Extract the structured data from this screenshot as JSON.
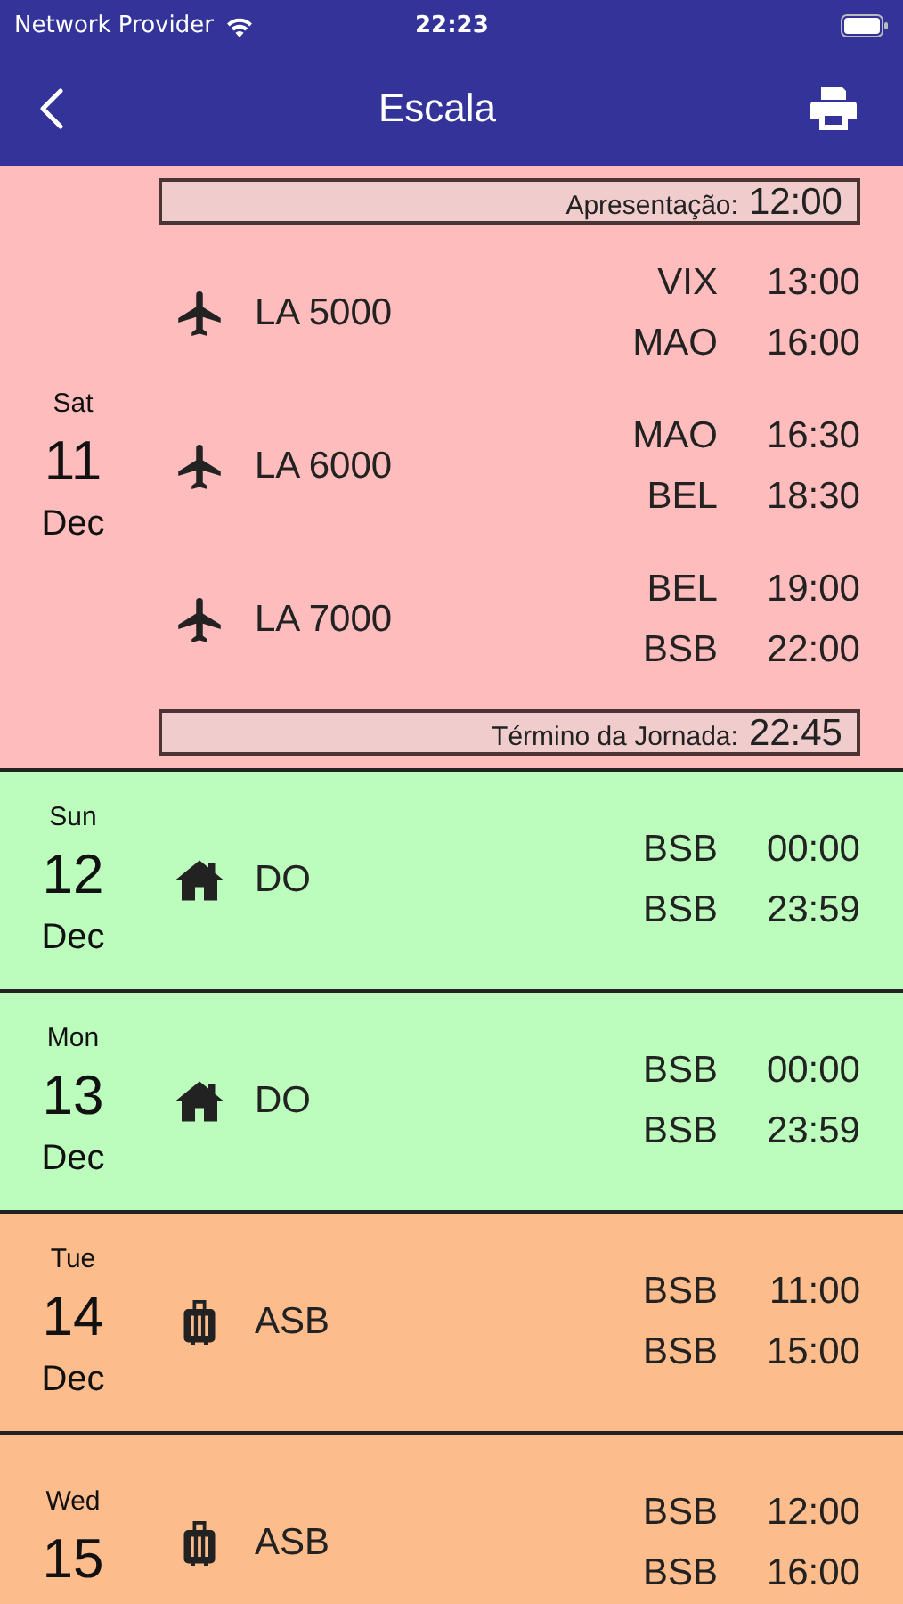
{
  "status_bar": {
    "carrier": "Network Provider",
    "time": "22:23"
  },
  "nav": {
    "title": "Escala"
  },
  "days": [
    {
      "weekday": "Sat",
      "day": "11",
      "month": "Dec",
      "color": "#ffbcbc",
      "report": {
        "label": "Apresentação:",
        "time": "12:00"
      },
      "end": {
        "label": "Término da Jornada:",
        "time": "22:45"
      },
      "duties": [
        {
          "kind": "flight",
          "code": "LA 5000",
          "legs": [
            {
              "airport": "VIX",
              "time": "13:00"
            },
            {
              "airport": "MAO",
              "time": "16:00"
            }
          ]
        },
        {
          "kind": "flight",
          "code": "LA 6000",
          "legs": [
            {
              "airport": "MAO",
              "time": "16:30"
            },
            {
              "airport": "BEL",
              "time": "18:30"
            }
          ]
        },
        {
          "kind": "flight",
          "code": "LA 7000",
          "legs": [
            {
              "airport": "BEL",
              "time": "19:00"
            },
            {
              "airport": "BSB",
              "time": "22:00"
            }
          ]
        }
      ]
    },
    {
      "weekday": "Sun",
      "day": "12",
      "month": "Dec",
      "color": "#bcfcbc",
      "duties": [
        {
          "kind": "home",
          "code": "DO",
          "legs": [
            {
              "airport": "BSB",
              "time": "00:00"
            },
            {
              "airport": "BSB",
              "time": "23:59"
            }
          ]
        }
      ]
    },
    {
      "weekday": "Mon",
      "day": "13",
      "month": "Dec",
      "color": "#bcfcbc",
      "duties": [
        {
          "kind": "home",
          "code": "DO",
          "legs": [
            {
              "airport": "BSB",
              "time": "00:00"
            },
            {
              "airport": "BSB",
              "time": "23:59"
            }
          ]
        }
      ]
    },
    {
      "weekday": "Tue",
      "day": "14",
      "month": "Dec",
      "color": "#fcbc8c",
      "duties": [
        {
          "kind": "standby",
          "code": "ASB",
          "legs": [
            {
              "airport": "BSB",
              "time": "11:00"
            },
            {
              "airport": "BSB",
              "time": "15:00"
            }
          ]
        }
      ]
    },
    {
      "weekday": "Wed",
      "day": "15",
      "color": "#fcbc8c",
      "duties": [
        {
          "kind": "standby",
          "code": "ASB",
          "legs": [
            {
              "airport": "BSB",
              "time": "12:00"
            },
            {
              "airport": "BSB",
              "time": "16:00"
            }
          ]
        }
      ]
    }
  ]
}
